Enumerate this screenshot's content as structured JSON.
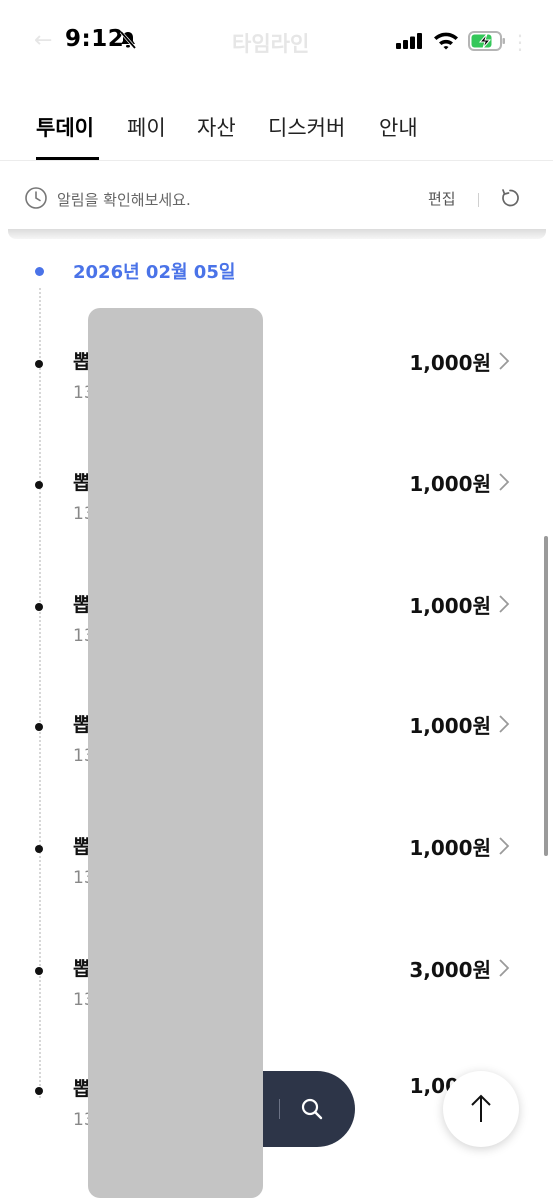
{
  "status_bar": {
    "time": "9:12",
    "bell_icon": "bell-slash-icon",
    "signal_icon": "cellular-signal-icon",
    "wifi_icon": "wifi-icon",
    "battery_icon": "battery-charging-icon",
    "battery_color": "#34c759"
  },
  "header_ghost": {
    "title": "타임라인"
  },
  "tabs": [
    {
      "label": "투데이",
      "active": true
    },
    {
      "label": "페이",
      "active": false
    },
    {
      "label": "자산",
      "active": false
    },
    {
      "label": "디스커버",
      "active": false
    },
    {
      "label": "안내",
      "active": false
    }
  ],
  "notice": {
    "text": "알림을 확인해보세요.",
    "edit_label": "편집"
  },
  "timeline": {
    "date": "2026년 02월 05일",
    "accent_color": "#4a73e8",
    "items": [
      {
        "title": "뽑",
        "sub": "13",
        "amount": "1,000원"
      },
      {
        "title": "뽑",
        "sub": "13",
        "amount": "1,000원"
      },
      {
        "title": "뽑",
        "sub": "13",
        "amount": "1,000원"
      },
      {
        "title": "뽑",
        "sub": "13",
        "amount": "1,000원"
      },
      {
        "title": "뽑",
        "sub": "13",
        "amount": "1,000원"
      },
      {
        "title": "뽑",
        "sub": "13",
        "amount": "3,000원"
      },
      {
        "title": "뽑",
        "sub": "13",
        "amount": "1,00"
      }
    ]
  },
  "floating": {
    "search_pill_color": "#2d3548"
  }
}
